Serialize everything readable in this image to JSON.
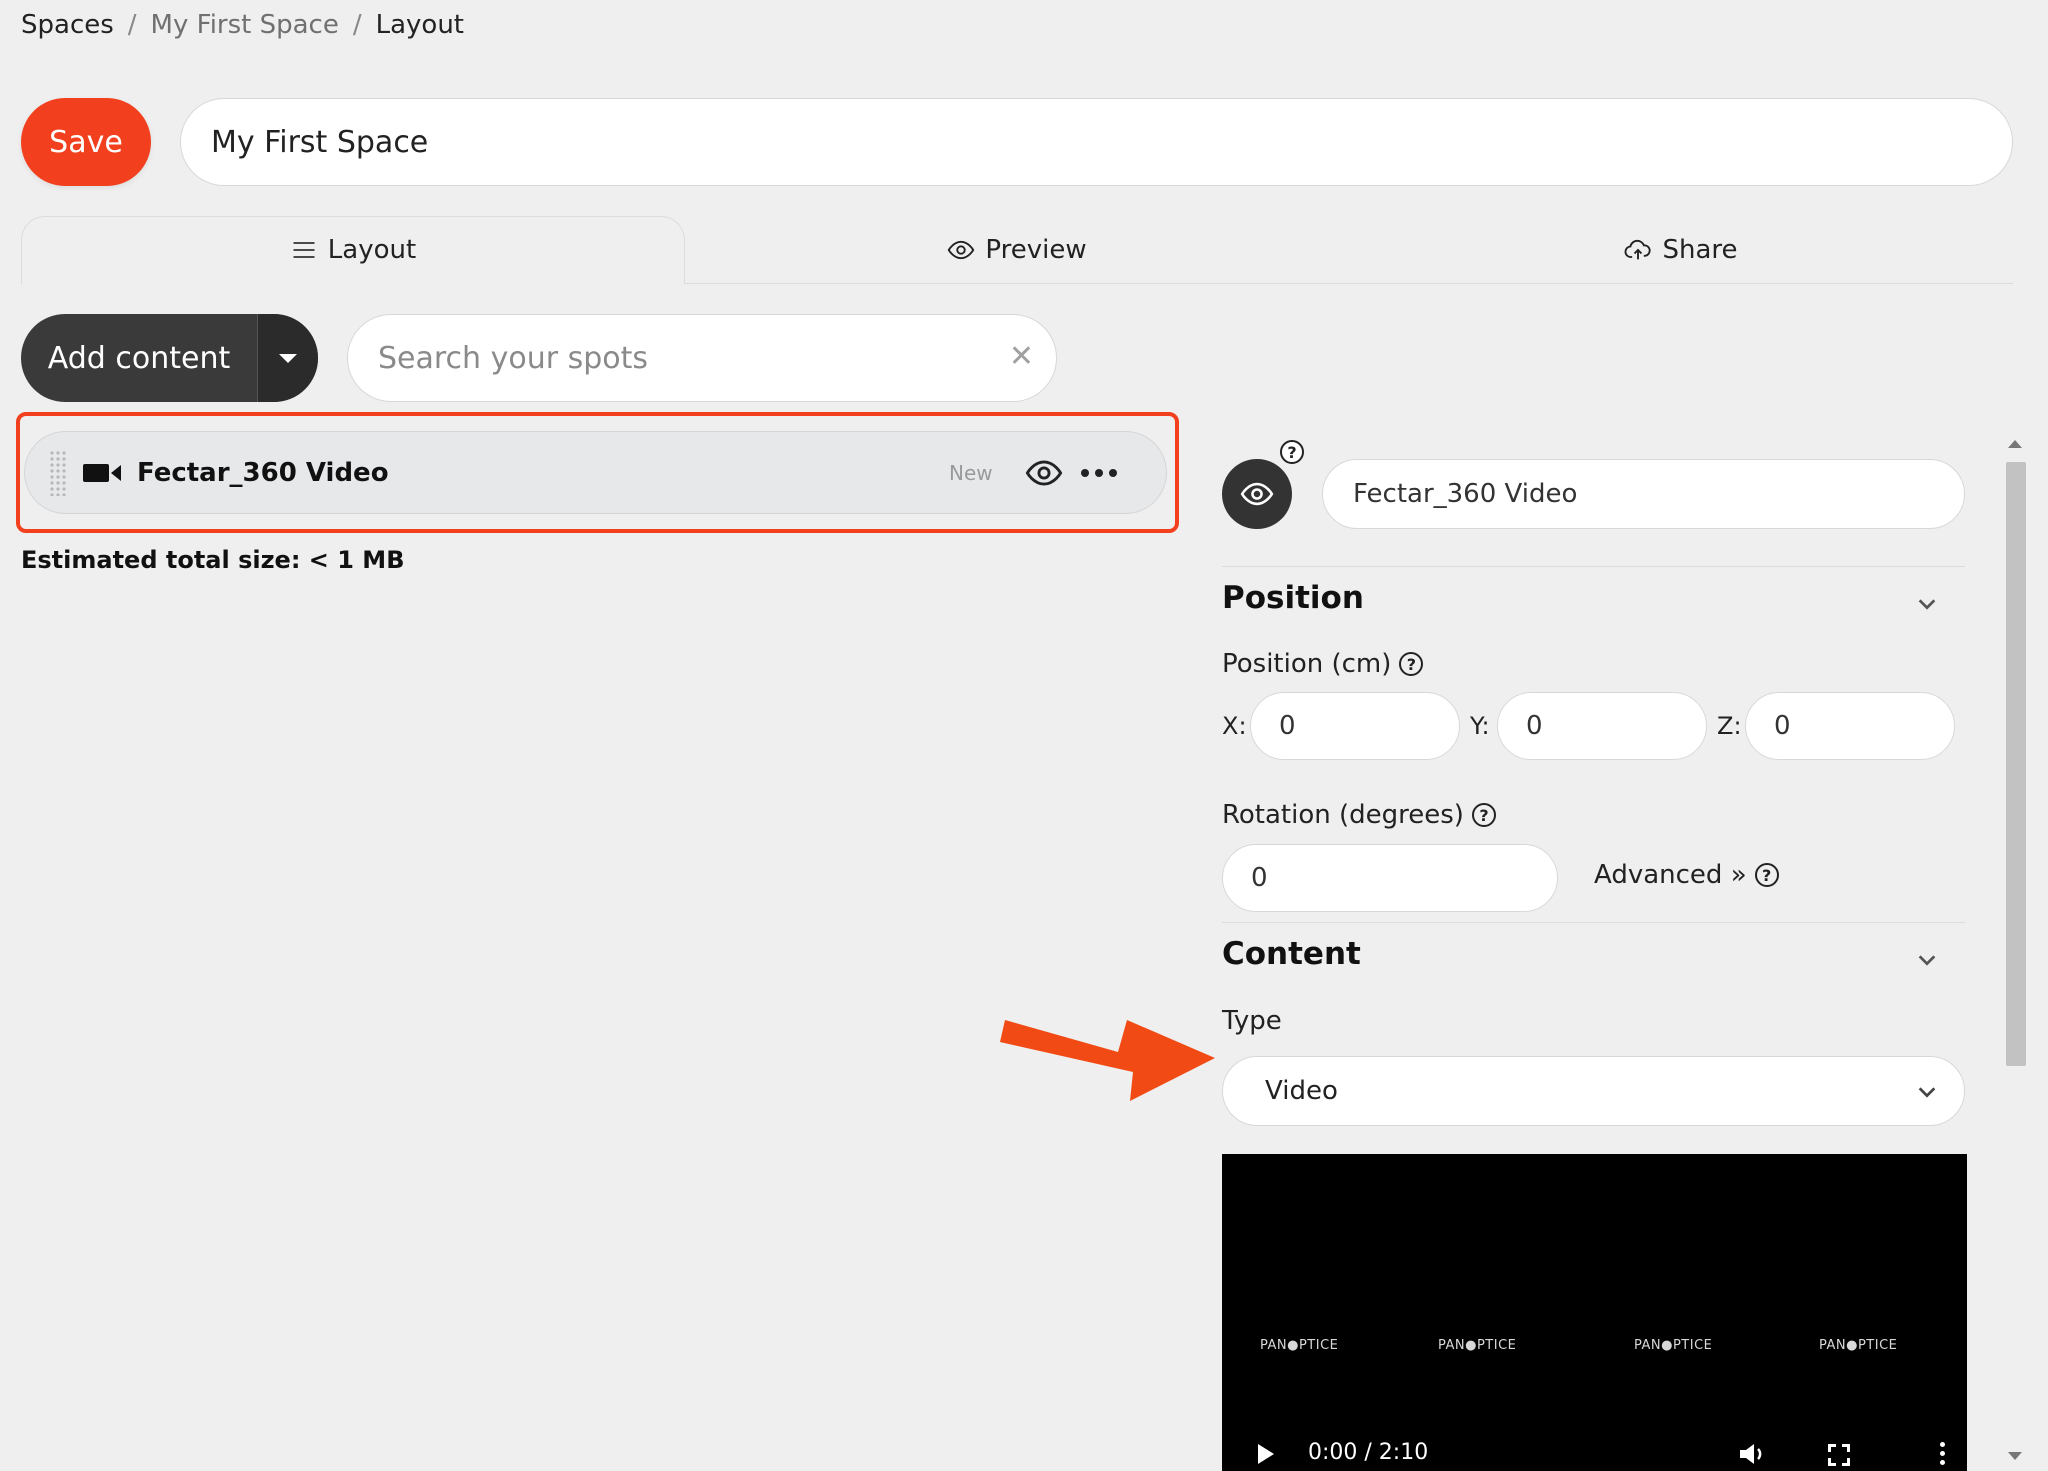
{
  "breadcrumb": {
    "items": [
      "Spaces",
      "My First Space",
      "Layout"
    ],
    "separator": "/"
  },
  "toolbar": {
    "save_label": "Save",
    "space_name": "My First Space"
  },
  "tabs": [
    {
      "label": "Layout",
      "icon": "menu-icon",
      "active": true
    },
    {
      "label": "Preview",
      "icon": "eye-icon",
      "active": false
    },
    {
      "label": "Share",
      "icon": "cloud-upload-icon",
      "active": false
    }
  ],
  "content_bar": {
    "add_label": "Add content",
    "search_placeholder": "Search your spots",
    "clear_icon": "close-icon"
  },
  "spots": [
    {
      "name": "Fectar_360 Video",
      "icon": "video-camera-icon",
      "badge": "New",
      "visible": true
    }
  ],
  "estimated_size": "Estimated total size: < 1 MB",
  "inspector": {
    "spot_name": "Fectar_360 Video",
    "position_section": {
      "title": "Position",
      "position_label": "Position (cm)",
      "x_label": "X:",
      "x_value": "0",
      "y_label": "Y:",
      "y_value": "0",
      "z_label": "Z:",
      "z_value": "0",
      "rotation_label": "Rotation (degrees)",
      "rotation_value": "0",
      "advanced_label": "Advanced »"
    },
    "content_section": {
      "title": "Content",
      "type_label": "Type",
      "type_value": "Video"
    },
    "video": {
      "watermarks": [
        "PAN●PTICE",
        "PAN●PTICE",
        "PAN●PTICE",
        "PAN●PTICE"
      ],
      "time": "0:00 / 2:10"
    }
  },
  "colors": {
    "accent": "#f2401e",
    "dark_button": "#3a3a3a",
    "background": "#efefef"
  }
}
